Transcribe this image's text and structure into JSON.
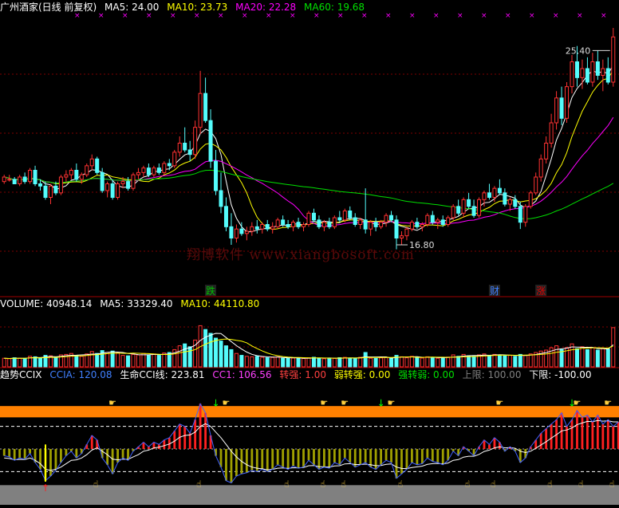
{
  "main_header": {
    "title": "广州酒家(日线 前复权)",
    "ma5": "MA5: 24.00",
    "ma10": "MA10: 23.73",
    "ma20": "MA20: 22.28",
    "ma60": "MA60: 19.68"
  },
  "price_labels": {
    "high": "25.40",
    "low": "16.80"
  },
  "event_markers": [
    {
      "label": "跌",
      "color": "#00c000"
    },
    {
      "label": "财",
      "color": "#4080ff"
    },
    {
      "label": "涨",
      "color": "#e00000"
    }
  ],
  "volume_header": {
    "volume": "VOLUME: 40948.14",
    "ma5": "MA5: 33329.40",
    "ma10": "MA10: 44110.80"
  },
  "indicator_header": {
    "name": "趋势CCIX",
    "ccia": "CCIA: 120.08",
    "life": "生命CCI线: 223.81",
    "cc1": "CC1: 106.56",
    "turn_strong": "转强: 1.00",
    "weak_to_strong": "弱转强: 0.00",
    "strong_to_weak": "强转弱: 0.00",
    "upper": "上限: 100.00",
    "lower": "下限: -100.00"
  },
  "watermark": "翔博软件 www.xiangbosoft.com",
  "colors": {
    "up": "#ff3232",
    "down": "#54fcfc",
    "ma5": "#ffffff",
    "ma10": "#ffff00",
    "ma20": "#ff00ff",
    "ma60": "#00e000",
    "band": "#ff8000",
    "gray_band": "#808080"
  },
  "chart_data": {
    "type": "candlestick",
    "price_range": [
      15.0,
      27.0
    ],
    "candles": [
      {
        "o": 19.6,
        "h": 19.9,
        "l": 19.5,
        "c": 19.8
      },
      {
        "o": 19.7,
        "h": 19.9,
        "l": 19.6,
        "c": 19.7
      },
      {
        "o": 19.7,
        "h": 19.8,
        "l": 19.5,
        "c": 19.5
      },
      {
        "o": 19.5,
        "h": 19.9,
        "l": 19.4,
        "c": 19.8
      },
      {
        "o": 19.8,
        "h": 20.0,
        "l": 19.5,
        "c": 19.6
      },
      {
        "o": 19.6,
        "h": 20.2,
        "l": 19.5,
        "c": 20.1
      },
      {
        "o": 20.1,
        "h": 20.3,
        "l": 19.4,
        "c": 19.5
      },
      {
        "o": 19.5,
        "h": 19.7,
        "l": 19.2,
        "c": 19.4
      },
      {
        "o": 19.4,
        "h": 19.6,
        "l": 18.8,
        "c": 18.9
      },
      {
        "o": 18.9,
        "h": 19.5,
        "l": 18.6,
        "c": 19.4
      },
      {
        "o": 19.4,
        "h": 19.6,
        "l": 19.0,
        "c": 19.1
      },
      {
        "o": 19.1,
        "h": 19.9,
        "l": 19.0,
        "c": 19.8
      },
      {
        "o": 19.8,
        "h": 20.1,
        "l": 19.6,
        "c": 19.9
      },
      {
        "o": 19.9,
        "h": 20.2,
        "l": 19.7,
        "c": 20.1
      },
      {
        "o": 20.1,
        "h": 20.4,
        "l": 19.6,
        "c": 19.7
      },
      {
        "o": 19.7,
        "h": 20.0,
        "l": 19.5,
        "c": 19.9
      },
      {
        "o": 19.9,
        "h": 20.4,
        "l": 19.8,
        "c": 20.3
      },
      {
        "o": 20.3,
        "h": 20.8,
        "l": 20.1,
        "c": 20.6
      },
      {
        "o": 20.6,
        "h": 20.7,
        "l": 19.9,
        "c": 20.0
      },
      {
        "o": 20.0,
        "h": 20.2,
        "l": 19.1,
        "c": 19.2
      },
      {
        "o": 19.2,
        "h": 19.6,
        "l": 18.9,
        "c": 19.5
      },
      {
        "o": 19.5,
        "h": 19.7,
        "l": 18.8,
        "c": 18.9
      },
      {
        "o": 18.9,
        "h": 19.6,
        "l": 18.8,
        "c": 19.5
      },
      {
        "o": 19.5,
        "h": 19.8,
        "l": 19.3,
        "c": 19.6
      },
      {
        "o": 19.6,
        "h": 19.8,
        "l": 19.2,
        "c": 19.3
      },
      {
        "o": 19.3,
        "h": 20.0,
        "l": 19.2,
        "c": 19.9
      },
      {
        "o": 19.9,
        "h": 20.2,
        "l": 19.7,
        "c": 20.0
      },
      {
        "o": 20.0,
        "h": 20.3,
        "l": 19.8,
        "c": 20.2
      },
      {
        "o": 20.2,
        "h": 20.4,
        "l": 19.8,
        "c": 19.9
      },
      {
        "o": 19.9,
        "h": 20.3,
        "l": 19.8,
        "c": 20.2
      },
      {
        "o": 20.2,
        "h": 20.4,
        "l": 19.9,
        "c": 20.0
      },
      {
        "o": 20.0,
        "h": 20.5,
        "l": 19.9,
        "c": 20.4
      },
      {
        "o": 20.4,
        "h": 20.6,
        "l": 20.1,
        "c": 20.3
      },
      {
        "o": 20.3,
        "h": 21.0,
        "l": 20.2,
        "c": 20.9
      },
      {
        "o": 20.9,
        "h": 21.6,
        "l": 20.7,
        "c": 21.3
      },
      {
        "o": 21.3,
        "h": 22.0,
        "l": 20.9,
        "c": 21.0
      },
      {
        "o": 21.0,
        "h": 21.4,
        "l": 20.5,
        "c": 20.8
      },
      {
        "o": 20.8,
        "h": 22.3,
        "l": 20.6,
        "c": 22.0
      },
      {
        "o": 22.0,
        "h": 24.5,
        "l": 21.7,
        "c": 23.5
      },
      {
        "o": 23.5,
        "h": 24.2,
        "l": 22.2,
        "c": 22.3
      },
      {
        "o": 22.3,
        "h": 22.8,
        "l": 20.2,
        "c": 20.5
      },
      {
        "o": 20.5,
        "h": 21.0,
        "l": 19.0,
        "c": 19.2
      },
      {
        "o": 19.2,
        "h": 20.0,
        "l": 18.2,
        "c": 18.5
      },
      {
        "o": 18.5,
        "h": 18.9,
        "l": 17.4,
        "c": 17.6
      },
      {
        "o": 17.6,
        "h": 18.2,
        "l": 16.8,
        "c": 17.1
      },
      {
        "o": 17.1,
        "h": 17.7,
        "l": 16.9,
        "c": 17.5
      },
      {
        "o": 17.5,
        "h": 17.8,
        "l": 17.2,
        "c": 17.3
      },
      {
        "o": 17.3,
        "h": 17.6,
        "l": 17.0,
        "c": 17.4
      },
      {
        "o": 17.4,
        "h": 17.8,
        "l": 17.2,
        "c": 17.6
      },
      {
        "o": 17.6,
        "h": 17.9,
        "l": 17.3,
        "c": 17.5
      },
      {
        "o": 17.5,
        "h": 17.8,
        "l": 17.3,
        "c": 17.7
      },
      {
        "o": 17.7,
        "h": 17.9,
        "l": 17.4,
        "c": 17.5
      },
      {
        "o": 17.5,
        "h": 17.8,
        "l": 17.3,
        "c": 17.6
      },
      {
        "o": 17.6,
        "h": 18.0,
        "l": 17.5,
        "c": 17.9
      },
      {
        "o": 17.9,
        "h": 18.1,
        "l": 17.6,
        "c": 17.7
      },
      {
        "o": 17.7,
        "h": 17.9,
        "l": 17.5,
        "c": 17.6
      },
      {
        "o": 17.6,
        "h": 17.9,
        "l": 17.4,
        "c": 17.8
      },
      {
        "o": 17.8,
        "h": 18.0,
        "l": 17.5,
        "c": 17.6
      },
      {
        "o": 17.6,
        "h": 17.8,
        "l": 17.4,
        "c": 17.7
      },
      {
        "o": 17.7,
        "h": 18.3,
        "l": 17.6,
        "c": 18.2
      },
      {
        "o": 18.2,
        "h": 18.4,
        "l": 17.8,
        "c": 17.9
      },
      {
        "o": 17.9,
        "h": 18.1,
        "l": 17.5,
        "c": 17.6
      },
      {
        "o": 17.6,
        "h": 17.9,
        "l": 17.4,
        "c": 17.8
      },
      {
        "o": 17.8,
        "h": 18.0,
        "l": 17.5,
        "c": 17.6
      },
      {
        "o": 17.6,
        "h": 18.1,
        "l": 17.5,
        "c": 18.0
      },
      {
        "o": 18.0,
        "h": 18.3,
        "l": 17.8,
        "c": 17.9
      },
      {
        "o": 17.9,
        "h": 18.4,
        "l": 17.8,
        "c": 18.3
      },
      {
        "o": 18.3,
        "h": 18.5,
        "l": 17.9,
        "c": 18.0
      },
      {
        "o": 18.0,
        "h": 18.2,
        "l": 17.6,
        "c": 17.7
      },
      {
        "o": 17.7,
        "h": 18.0,
        "l": 17.5,
        "c": 17.9
      },
      {
        "o": 17.9,
        "h": 19.3,
        "l": 17.3,
        "c": 17.5
      },
      {
        "o": 17.5,
        "h": 17.9,
        "l": 17.2,
        "c": 17.8
      },
      {
        "o": 17.8,
        "h": 18.0,
        "l": 17.4,
        "c": 17.6
      },
      {
        "o": 17.6,
        "h": 17.9,
        "l": 17.5,
        "c": 17.8
      },
      {
        "o": 17.8,
        "h": 18.2,
        "l": 17.6,
        "c": 18.1
      },
      {
        "o": 18.1,
        "h": 18.3,
        "l": 17.8,
        "c": 17.9
      },
      {
        "o": 17.9,
        "h": 18.1,
        "l": 16.6,
        "c": 17.1
      },
      {
        "o": 17.1,
        "h": 17.4,
        "l": 16.8,
        "c": 17.2
      },
      {
        "o": 17.2,
        "h": 17.6,
        "l": 17.0,
        "c": 17.5
      },
      {
        "o": 17.5,
        "h": 17.9,
        "l": 17.4,
        "c": 17.8
      },
      {
        "o": 17.8,
        "h": 18.0,
        "l": 17.5,
        "c": 17.6
      },
      {
        "o": 17.6,
        "h": 17.8,
        "l": 17.4,
        "c": 17.7
      },
      {
        "o": 17.7,
        "h": 18.2,
        "l": 17.6,
        "c": 18.1
      },
      {
        "o": 18.1,
        "h": 18.3,
        "l": 17.7,
        "c": 17.8
      },
      {
        "o": 17.8,
        "h": 18.0,
        "l": 17.5,
        "c": 17.9
      },
      {
        "o": 17.9,
        "h": 18.1,
        "l": 17.6,
        "c": 17.7
      },
      {
        "o": 17.7,
        "h": 18.1,
        "l": 17.6,
        "c": 18.0
      },
      {
        "o": 18.0,
        "h": 18.6,
        "l": 17.9,
        "c": 18.5
      },
      {
        "o": 18.5,
        "h": 18.8,
        "l": 18.1,
        "c": 18.2
      },
      {
        "o": 18.2,
        "h": 18.9,
        "l": 18.0,
        "c": 18.8
      },
      {
        "o": 18.8,
        "h": 19.1,
        "l": 18.4,
        "c": 18.5
      },
      {
        "o": 18.5,
        "h": 18.8,
        "l": 18.0,
        "c": 18.1
      },
      {
        "o": 18.1,
        "h": 18.9,
        "l": 18.0,
        "c": 18.8
      },
      {
        "o": 18.8,
        "h": 19.2,
        "l": 18.5,
        "c": 19.1
      },
      {
        "o": 19.1,
        "h": 19.5,
        "l": 18.8,
        "c": 18.9
      },
      {
        "o": 18.9,
        "h": 19.4,
        "l": 18.7,
        "c": 19.3
      },
      {
        "o": 19.3,
        "h": 19.7,
        "l": 19.0,
        "c": 19.1
      },
      {
        "o": 19.1,
        "h": 19.3,
        "l": 18.5,
        "c": 18.6
      },
      {
        "o": 18.6,
        "h": 18.9,
        "l": 18.3,
        "c": 18.8
      },
      {
        "o": 18.8,
        "h": 19.0,
        "l": 18.4,
        "c": 18.5
      },
      {
        "o": 18.5,
        "h": 18.7,
        "l": 17.5,
        "c": 17.8
      },
      {
        "o": 17.8,
        "h": 18.6,
        "l": 17.6,
        "c": 18.5
      },
      {
        "o": 18.5,
        "h": 19.2,
        "l": 18.4,
        "c": 19.1
      },
      {
        "o": 19.1,
        "h": 20.0,
        "l": 19.0,
        "c": 19.8
      },
      {
        "o": 19.8,
        "h": 20.8,
        "l": 19.6,
        "c": 20.6
      },
      {
        "o": 20.6,
        "h": 21.6,
        "l": 20.4,
        "c": 21.3
      },
      {
        "o": 21.3,
        "h": 22.6,
        "l": 21.1,
        "c": 22.2
      },
      {
        "o": 22.2,
        "h": 23.6,
        "l": 21.9,
        "c": 23.3
      },
      {
        "o": 23.3,
        "h": 23.8,
        "l": 22.1,
        "c": 22.4
      },
      {
        "o": 22.4,
        "h": 24.0,
        "l": 22.2,
        "c": 23.8
      },
      {
        "o": 23.8,
        "h": 25.2,
        "l": 23.5,
        "c": 24.9
      },
      {
        "o": 24.9,
        "h": 25.6,
        "l": 23.8,
        "c": 24.2
      },
      {
        "o": 24.2,
        "h": 25.0,
        "l": 23.7,
        "c": 24.6
      },
      {
        "o": 24.6,
        "h": 25.1,
        "l": 23.9,
        "c": 24.0
      },
      {
        "o": 24.0,
        "h": 25.3,
        "l": 23.8,
        "c": 24.9
      },
      {
        "o": 24.9,
        "h": 25.4,
        "l": 24.1,
        "c": 24.3
      },
      {
        "o": 24.3,
        "h": 25.0,
        "l": 23.6,
        "c": 24.6
      },
      {
        "o": 24.6,
        "h": 25.1,
        "l": 23.9,
        "c": 24.0
      },
      {
        "o": 24.0,
        "h": 26.4,
        "l": 23.8,
        "c": 26.0
      }
    ],
    "ma_series": [
      {
        "name": "MA5",
        "color": "#ffffff",
        "period": 5
      },
      {
        "name": "MA10",
        "color": "#ffff00",
        "period": 10
      },
      {
        "name": "MA20",
        "color": "#ff00ff",
        "period": 20
      },
      {
        "name": "MA60",
        "color": "#00e000",
        "period": 60
      }
    ],
    "volume": {
      "range": [
        0,
        60000
      ],
      "values": [
        9000,
        8500,
        9500,
        9000,
        8800,
        11000,
        10500,
        9000,
        12000,
        11500,
        9500,
        12500,
        13000,
        14000,
        12000,
        11000,
        13500,
        16000,
        14000,
        17000,
        15000,
        16500,
        14500,
        12000,
        11500,
        13000,
        12500,
        14000,
        12000,
        13500,
        12000,
        14500,
        15000,
        18000,
        22000,
        24000,
        21000,
        28000,
        43000,
        39000,
        35000,
        30000,
        27000,
        22000,
        18000,
        14000,
        12000,
        11000,
        10500,
        11000,
        10000,
        9500,
        9800,
        10500,
        9000,
        8800,
        9200,
        9000,
        8700,
        9500,
        10000,
        9000,
        8500,
        9200,
        8800,
        9600,
        9900,
        9100,
        8700,
        10000,
        15000,
        9000,
        8800,
        9400,
        9800,
        9000,
        12000,
        10500,
        9500,
        11000,
        10000,
        9200,
        10500,
        9800,
        9000,
        9400,
        10200,
        12500,
        11000,
        13000,
        11500,
        11000,
        12500,
        13500,
        12000,
        13000,
        12500,
        11500,
        12000,
        11000,
        13000,
        12000,
        13500,
        15000,
        16500,
        17500,
        20000,
        22000,
        18000,
        20000,
        24000,
        19000,
        21000,
        18000,
        20000,
        17500,
        19000,
        18500,
        40948
      ]
    },
    "indicator": {
      "range": [
        -180,
        300
      ],
      "upper": 100,
      "lower": -100,
      "cci": [
        -30,
        -35,
        -50,
        -40,
        -45,
        -20,
        -60,
        -90,
        -140,
        -120,
        -95,
        -60,
        -30,
        -10,
        -40,
        -20,
        20,
        60,
        40,
        -40,
        -70,
        -110,
        -60,
        -40,
        -50,
        -10,
        10,
        30,
        10,
        30,
        20,
        40,
        50,
        80,
        110,
        100,
        70,
        130,
        200,
        160,
        60,
        -30,
        -80,
        -140,
        -150,
        -120,
        -110,
        -105,
        -95,
        -100,
        -90,
        -100,
        -90,
        -70,
        -80,
        -90,
        -75,
        -85,
        -80,
        -50,
        -70,
        -90,
        -80,
        -85,
        -60,
        -70,
        -40,
        -60,
        -80,
        -70,
        -60,
        -80,
        -90,
        -70,
        -50,
        -60,
        -130,
        -110,
        -90,
        -60,
        -70,
        -65,
        -40,
        -55,
        -60,
        -70,
        -50,
        -10,
        -30,
        10,
        -10,
        -30,
        10,
        40,
        20,
        50,
        30,
        -10,
        10,
        -10,
        -60,
        -40,
        10,
        40,
        70,
        90,
        110,
        130,
        160,
        100,
        130,
        170,
        140,
        150,
        120,
        150,
        110,
        130,
        100,
        120
      ],
      "life_line": [
        -40,
        -42,
        -48,
        -46,
        -47,
        -40,
        -50,
        -65,
        -90,
        -95,
        -90,
        -80,
        -65,
        -50,
        -48,
        -40,
        -25,
        -5,
        5,
        -10,
        -25,
        -45,
        -48,
        -45,
        -46,
        -35,
        -25,
        -10,
        -5,
        5,
        8,
        15,
        22,
        35,
        52,
        60,
        62,
        75,
        100,
        112,
        100,
        75,
        50,
        20,
        -10,
        -35,
        -55,
        -70,
        -80,
        -85,
        -88,
        -92,
        -90,
        -85,
        -84,
        -86,
        -83,
        -84,
        -82,
        -74,
        -73,
        -78,
        -79,
        -80,
        -75,
        -74,
        -66,
        -65,
        -69,
        -69,
        -67,
        -70,
        -74,
        -73,
        -68,
        -66,
        -80,
        -86,
        -87,
        -82,
        -79,
        -76,
        -68,
        -65,
        -64,
        -66,
        -62,
        -50,
        -47,
        -36,
        -32,
        -32,
        -24,
        -11,
        -5,
        5,
        10,
        5,
        6,
        3,
        -10,
        -16,
        -10,
        3,
        18,
        32,
        48,
        63,
        80,
        84,
        93,
        108,
        115,
        122,
        121,
        126,
        123,
        125,
        120,
        120
      ]
    }
  }
}
